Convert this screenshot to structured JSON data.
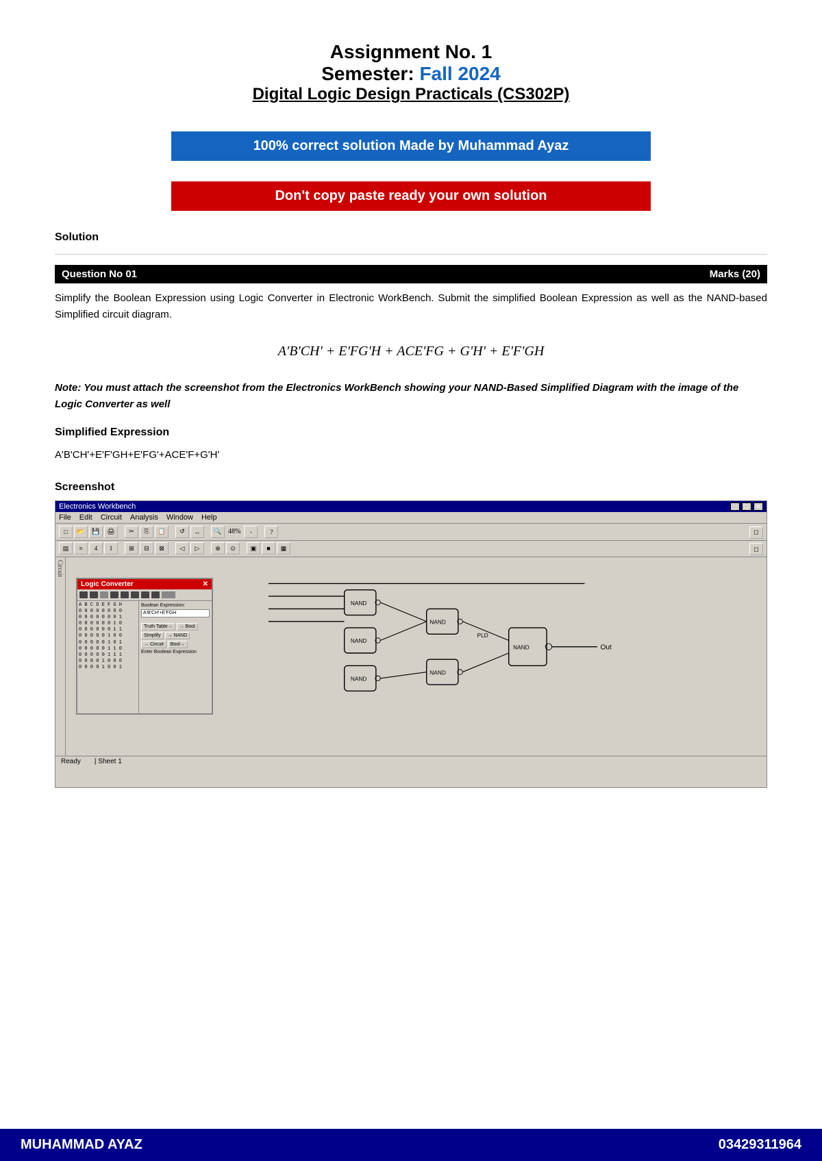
{
  "header": {
    "title": "Assignment No. 1",
    "semester_label": "Semester:  ",
    "semester_value": "Fall 2024",
    "course": "Digital Logic Design Practicals (CS302P)"
  },
  "banners": {
    "blue_text": "100% correct solution Made by Muhammad Ayaz",
    "red_text": "Don't copy paste ready your own solution"
  },
  "solution": {
    "label": "Solution"
  },
  "question": {
    "number_label": "Question No 01",
    "marks_label": "Marks",
    "marks_value": "(20)",
    "description": "Simplify  the  Boolean  Expression  using  Logic  Converter  in  Electronic  WorkBench.  Submit  the simplified Boolean Expression as well as the NAND-based Simplified circuit diagram.",
    "expression": "A'B'CH' + E'FG'H + ACE'FG + G'H' + E'F'GH",
    "note": "Note: You must attach the screenshot from the Electronics WorkBench showing your NAND-Based Simplified Diagram with the image of the Logic Converter as well"
  },
  "simplified": {
    "label": "Simplified Expression",
    "expr": "A'B'CH'+E'F'GH+E'FG'+ACE'F+G'H'"
  },
  "screenshot": {
    "label": "Screenshot",
    "app_title": "Electronics Workbench",
    "menu_items": [
      "File",
      "Edit",
      "Circuit",
      "Analysis",
      "Window",
      "Help"
    ],
    "status": "Ready",
    "page_info": "Sheet 1"
  },
  "footer": {
    "name": "MUHAMMAD AYAZ",
    "phone": "03429311964"
  }
}
